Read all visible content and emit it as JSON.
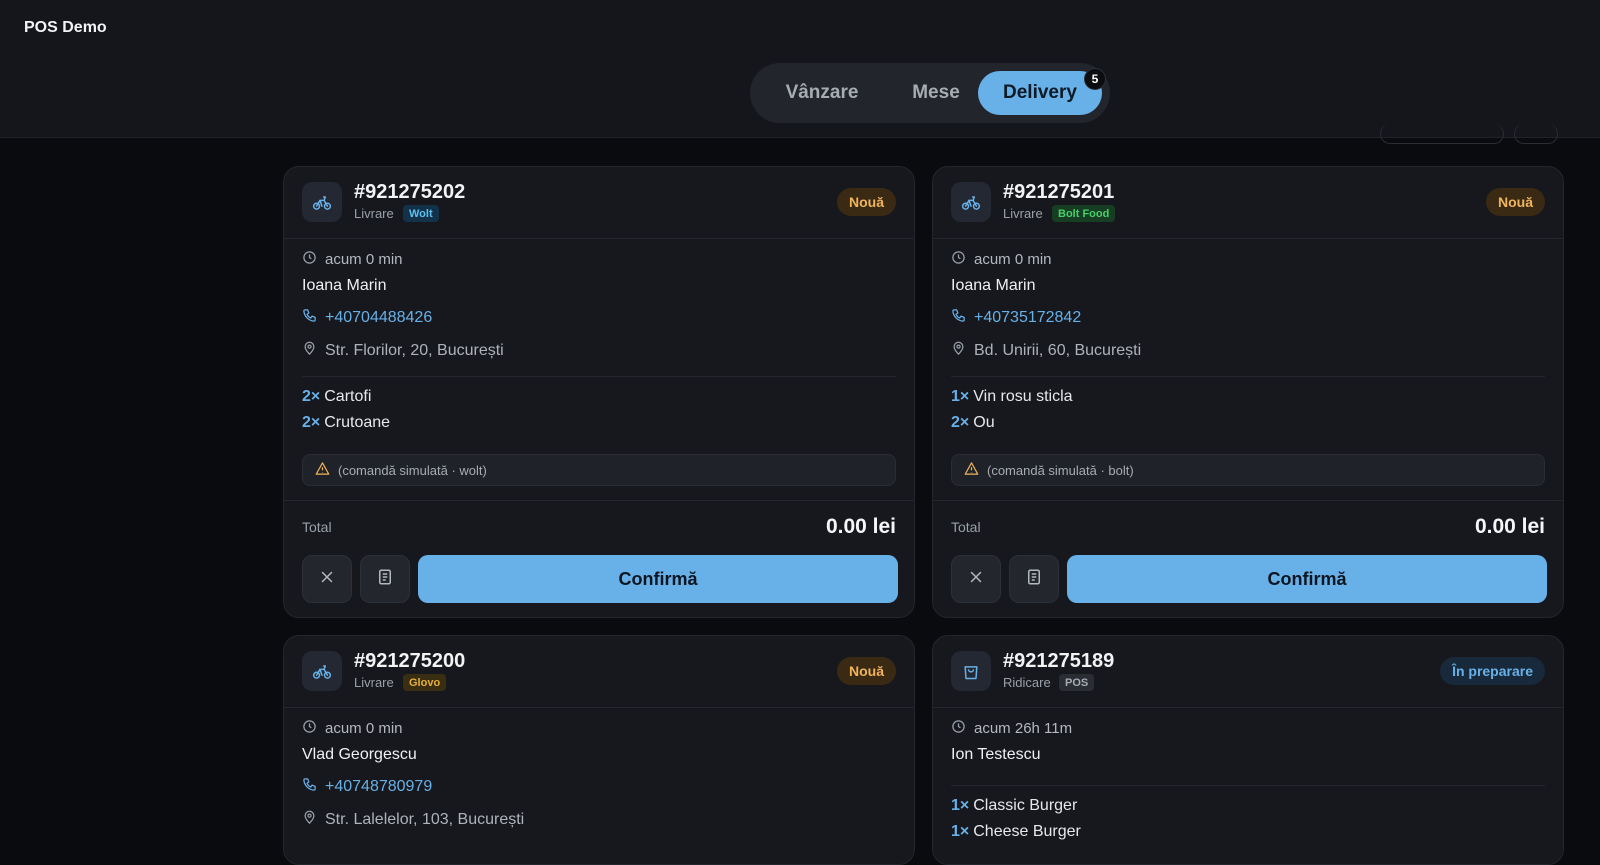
{
  "app": {
    "title": "POS Demo"
  },
  "tabs": [
    {
      "label": "Vânzare",
      "active": false
    },
    {
      "label": "Mese",
      "active": false
    },
    {
      "label": "Delivery",
      "active": true,
      "badge": "5"
    }
  ],
  "colors": {
    "accent": "#68b0e8",
    "new_badge": "#f0b45a",
    "wolt": "#3da8e0",
    "bolt": "#34c759",
    "glovo": "#e0a020"
  },
  "orders": [
    {
      "id": "#921275202",
      "type": "Livrare",
      "platform": "Wolt",
      "status": "Nouă",
      "icon": "bicycle-icon",
      "time": "acum 0 min",
      "customer": "Ioana Marin",
      "phone": "+40704488426",
      "address": "Str. Florilor, 20, București",
      "items": [
        {
          "qty": "2×",
          "name": "Cartofi"
        },
        {
          "qty": "2×",
          "name": "Crutoane"
        }
      ],
      "note": "(comandă simulată · wolt)",
      "total_label": "Total",
      "total": "0.00 lei",
      "confirm_label": "Confirmă"
    },
    {
      "id": "#921275201",
      "type": "Livrare",
      "platform": "Bolt Food",
      "status": "Nouă",
      "icon": "bicycle-icon",
      "time": "acum 0 min",
      "customer": "Ioana Marin",
      "phone": "+40735172842",
      "address": "Bd. Unirii, 60, București",
      "items": [
        {
          "qty": "1×",
          "name": "Vin rosu sticla"
        },
        {
          "qty": "2×",
          "name": "Ou"
        }
      ],
      "note": "(comandă simulată · bolt)",
      "total_label": "Total",
      "total": "0.00 lei",
      "confirm_label": "Confirmă"
    },
    {
      "id": "#921275200",
      "type": "Livrare",
      "platform": "Glovo",
      "status": "Nouă",
      "icon": "bicycle-icon",
      "time": "acum 0 min",
      "customer": "Vlad Georgescu",
      "phone": "+40748780979",
      "address": "Str. Lalelelor, 103, București"
    },
    {
      "id": "#921275189",
      "type": "Ridicare",
      "platform": "POS",
      "status": "În preparare",
      "icon": "shopping-bag-icon",
      "time": "acum 26h 11m",
      "customer": "Ion Testescu",
      "items": [
        {
          "qty": "1×",
          "name": "Classic Burger"
        },
        {
          "qty": "1×",
          "name": "Cheese Burger"
        }
      ]
    }
  ]
}
